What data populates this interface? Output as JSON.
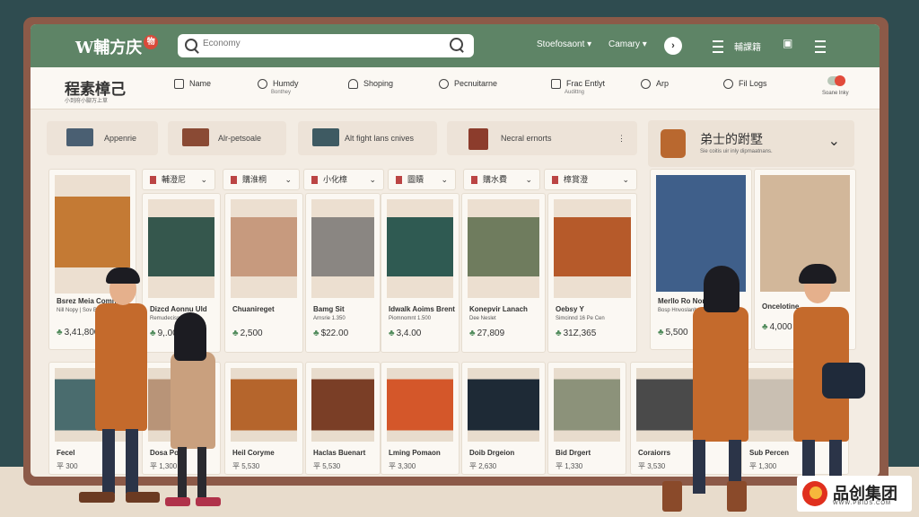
{
  "topbar": {
    "logo_text": "W輔方庆",
    "logo_badge": "物",
    "search_placeholder": "Economy",
    "nav_dropdowns": [
      "Stoefosaont",
      "Camary"
    ],
    "right_text": "輔課籍"
  },
  "category_bar": {
    "title": "程素樟己",
    "subtitle": "小到府小腳万上草",
    "items": [
      {
        "label": "Name",
        "sub": ""
      },
      {
        "label": "Humdy",
        "sub": "Bonthey"
      },
      {
        "label": "Shoping",
        "sub": ""
      },
      {
        "label": "Pecnuitarne",
        "sub": ""
      },
      {
        "label": "Frac Entlyt",
        "sub": "Audittng"
      },
      {
        "label": "Arp",
        "sub": ""
      },
      {
        "label": "Fil Logs",
        "sub": ""
      }
    ],
    "toggle_label": "Soane lnky"
  },
  "tiles": [
    {
      "label": "Appenrie",
      "color": "#4a5f72"
    },
    {
      "label": "Alr-petsoale",
      "color": "#8a4a34"
    },
    {
      "label": "Alt fight lans cnives",
      "color": "#3e5a62"
    },
    {
      "label": "Necral ernorts",
      "color": "#8c3c2c"
    }
  ],
  "filters": [
    "輔澄尼",
    "購淮桐",
    "小化樟",
    "圖贖",
    "購水費",
    "樟賞澄"
  ],
  "side_panel": {
    "title": "弟士的跗墅",
    "subtitle": "Sie coitis uir inly dipmaatnans.",
    "cards": [
      {
        "name": "Merllo Ro Nor",
        "desc": "Bosp Hnvoslanhsy",
        "price": "5,500"
      },
      {
        "name": "Oncelotine",
        "desc": "",
        "price": "4,000"
      }
    ]
  },
  "products_row1": [
    {
      "name": "Bsrez Meia Comns",
      "desc": "Nill Nopy | Sov Bnoodt",
      "price": "3,41,800",
      "img": "#c47a34"
    },
    {
      "name": "Dizcd Aonnu Uld",
      "desc": "Remudeciss",
      "price": "9,.00",
      "img": "#35574d"
    },
    {
      "name": "Chuanireget",
      "desc": "",
      "price": "2,500",
      "img": "#c79a7e"
    },
    {
      "name": "Bamg Sit",
      "desc": "Arnsrie 1.350",
      "price": "$22.00",
      "img": "#8a8682"
    },
    {
      "name": "Idwalk Aoims Brent",
      "desc": "Piomnomnt 1.500",
      "price": "3,4.00",
      "img": "#2f5a52"
    },
    {
      "name": "Konepvir Lanach",
      "desc": "Dee Neslet",
      "price": "27,809",
      "img": "#6f7c5e"
    },
    {
      "name": "Oebsy Y",
      "desc": "Simcinnd 16 Pe Cen",
      "price": "31Z,365",
      "img": "#b65a2a"
    }
  ],
  "products_row2": [
    {
      "name": "Fecel",
      "price": "平 300",
      "img": "#4a6c6e"
    },
    {
      "name": "Dosa Port",
      "price": "平 1,300",
      "img": "#b89478"
    },
    {
      "name": "Heil Coryme",
      "price": "平 5,530",
      "img": "#b5652c"
    },
    {
      "name": "Haclas Buenart",
      "price": "平 5,530",
      "img": "#7a3e26"
    },
    {
      "name": "Lming Pomaon",
      "price": "平 3,300",
      "img": "#d4572a"
    },
    {
      "name": "Doib Drgeion",
      "price": "平 2,630",
      "img": "#1e2a36"
    },
    {
      "name": "Bid Drgert",
      "price": "平 1,330",
      "img": "#8c927a"
    },
    {
      "name": "Coraiorrs",
      "price": "平 3,530",
      "img": "#4a4a4a"
    },
    {
      "name": "Sub Percen",
      "price": "平 1,300",
      "img": "#c9bfb2"
    }
  ],
  "watermark": {
    "text": "品创集团",
    "url": "WWW.PBIDS.COM"
  }
}
